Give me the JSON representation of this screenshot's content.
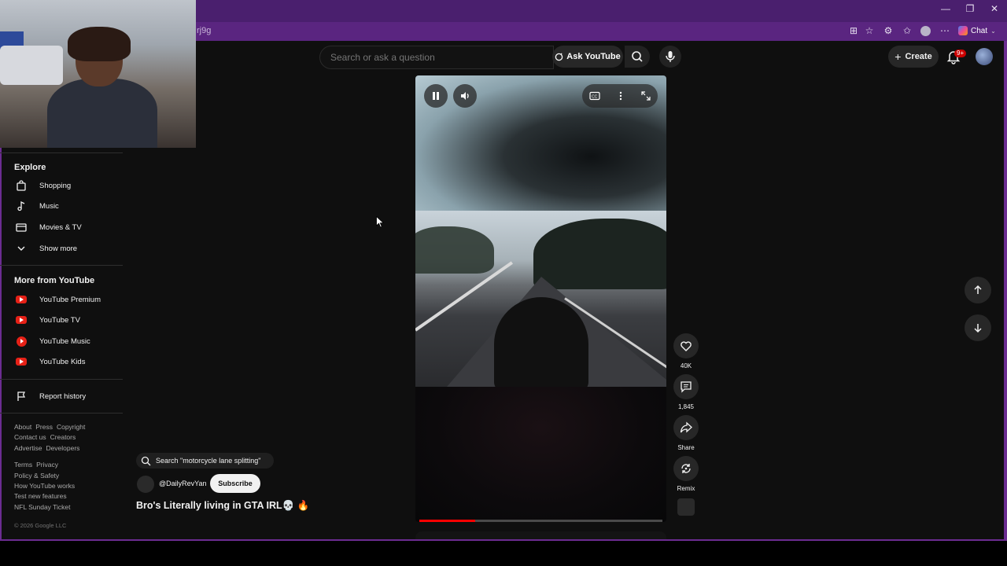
{
  "browser": {
    "url_fragment": "rj9g",
    "chat_label": "Chat",
    "window_controls": [
      "—",
      "❐",
      "✕"
    ],
    "toolbar_icons": [
      "tab-icon",
      "star-icon",
      "extension-icon",
      "favorites-icon",
      "profile-icon",
      "more-icon"
    ]
  },
  "header": {
    "search_placeholder": "Search or ask a question",
    "ask_label": "Ask YouTube",
    "create_label": "Create",
    "notification_badge": "9+"
  },
  "sidebar": {
    "explore_title": "Explore",
    "explore_items": [
      {
        "label": "Shopping",
        "icon": "shopping-bag-icon"
      },
      {
        "label": "Music",
        "icon": "music-note-icon"
      },
      {
        "label": "Movies & TV",
        "icon": "clapperboard-icon"
      },
      {
        "label": "Show more",
        "icon": "chevron-down-icon"
      }
    ],
    "more_title": "More from YouTube",
    "more_items": [
      {
        "label": "YouTube Premium",
        "icon": "youtube-premium-icon"
      },
      {
        "label": "YouTube TV",
        "icon": "youtube-tv-icon"
      },
      {
        "label": "YouTube Music",
        "icon": "youtube-music-icon"
      },
      {
        "label": "YouTube Kids",
        "icon": "youtube-kids-icon"
      }
    ],
    "report_history": "Report history",
    "footer1": [
      "About",
      "Press",
      "Copyright"
    ],
    "footer2": [
      "Contact us",
      "Creators"
    ],
    "footer3": [
      "Advertise",
      "Developers"
    ],
    "footer4": [
      "Terms",
      "Privacy"
    ],
    "footer5": [
      "Policy & Safety"
    ],
    "footer6": [
      "How YouTube works"
    ],
    "footer7": [
      "Test new features"
    ],
    "footer8": [
      "NFL Sunday Ticket"
    ],
    "copyright": "© 2026 Google LLC"
  },
  "short": {
    "search_suggestion": "Search \"motorcycle lane splitting\"",
    "channel": "@DailyRevYan",
    "subscribe_label": "Subscribe",
    "title": "Bro's Literally living in GTA IRL💀 🔥",
    "progress": 0.23
  },
  "actions": {
    "like_count": "40K",
    "comment_count": "1,845",
    "share_label": "Share",
    "remix_label": "Remix"
  },
  "colors": {
    "frame": "#6b2c91",
    "background": "#0f0f0f",
    "accent_red": "#ff0000"
  }
}
